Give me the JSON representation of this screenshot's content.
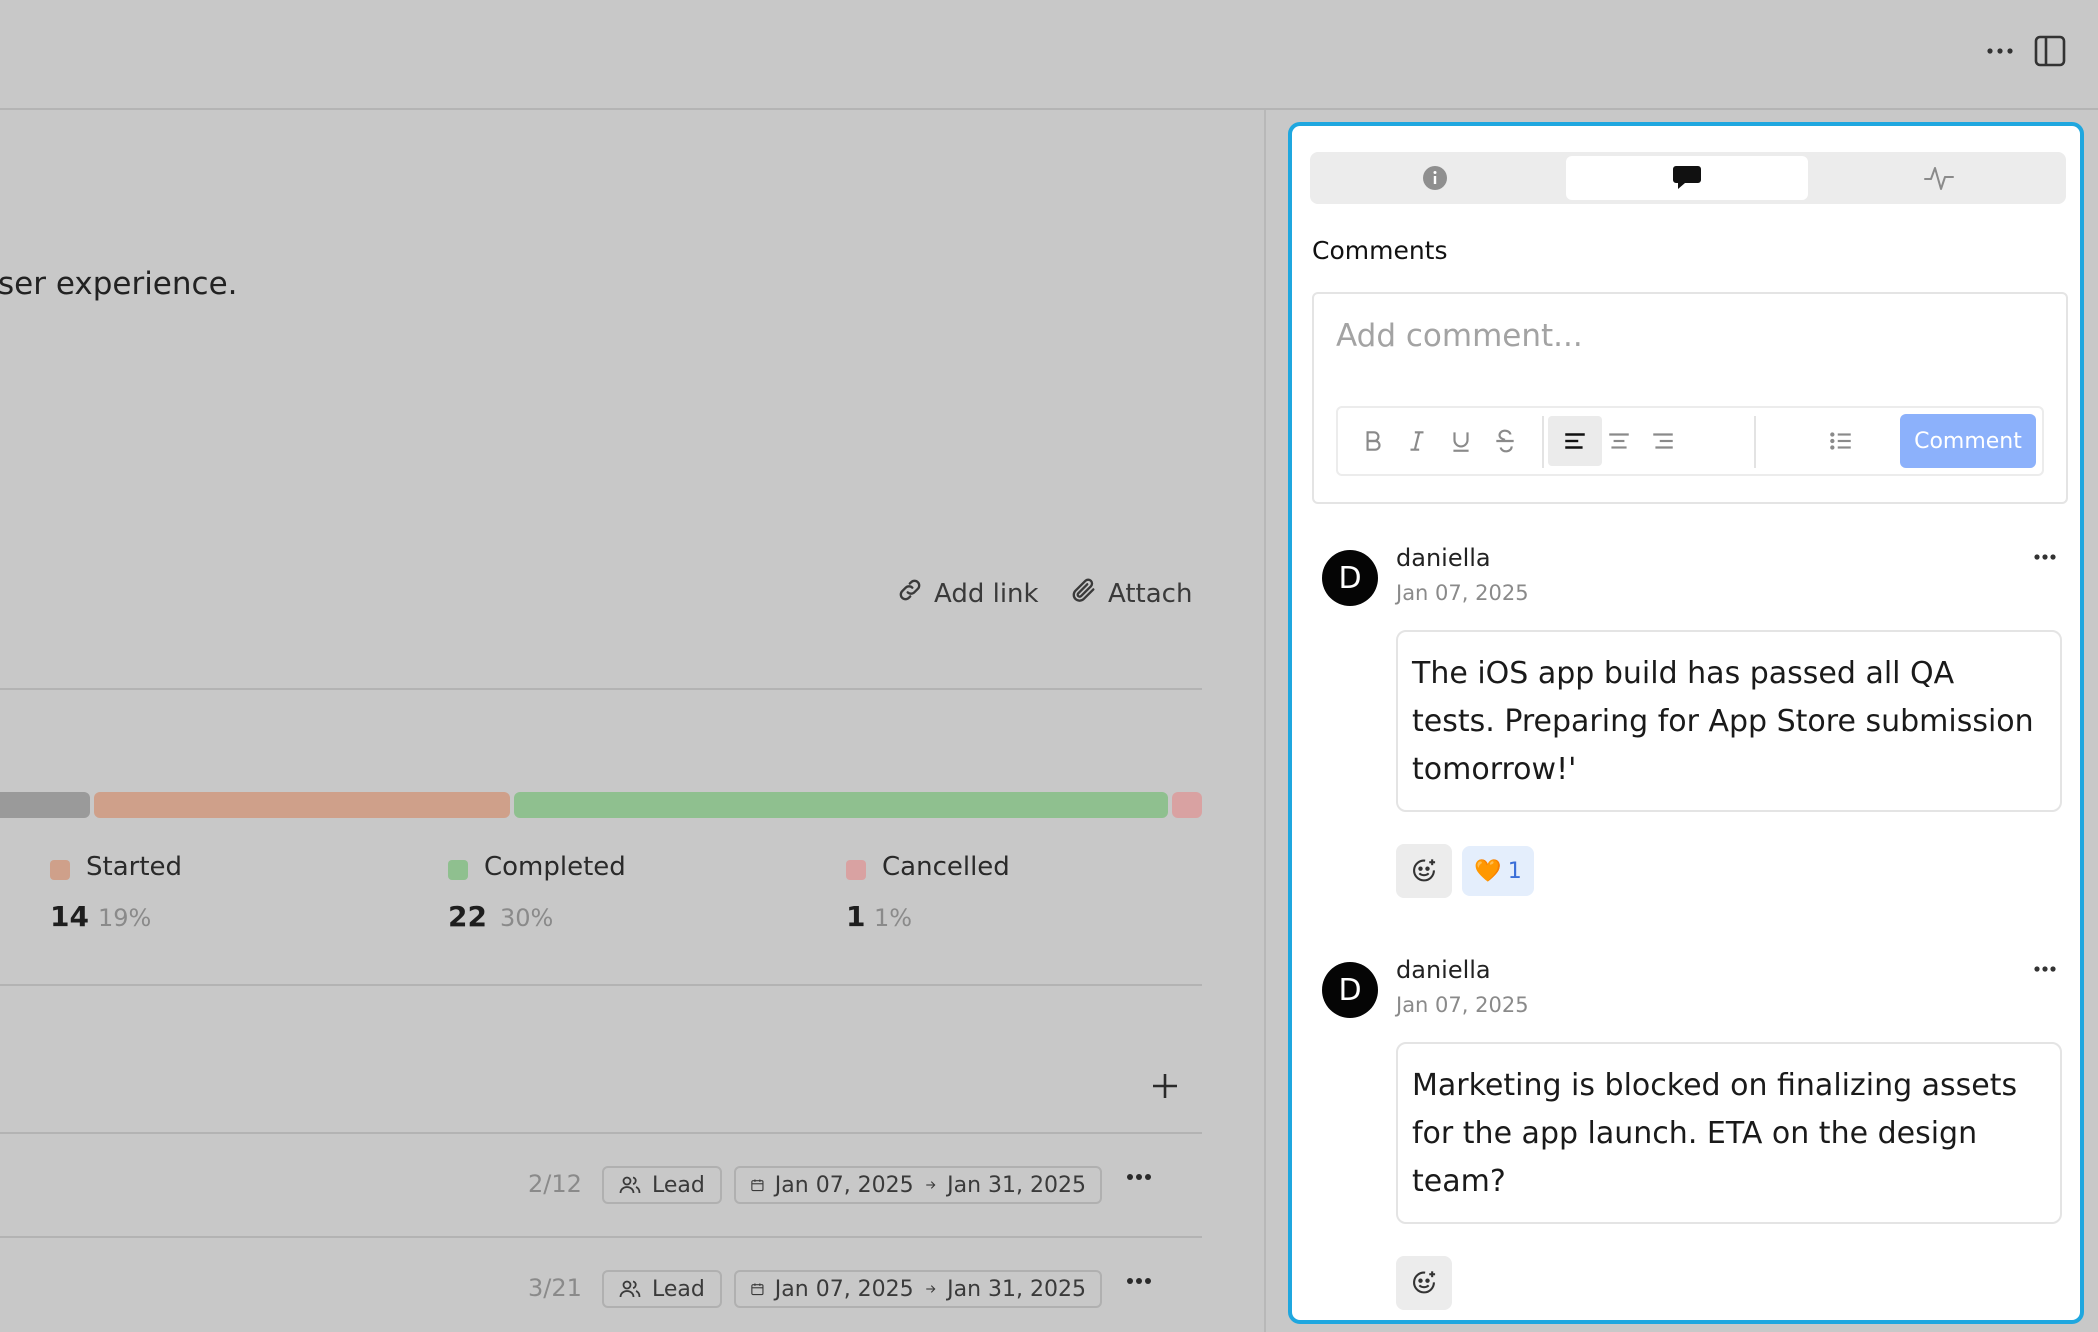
{
  "topbar": {
    "more_icon": "more-horizontal-icon",
    "panel_icon": "sidebar-panel-icon"
  },
  "main": {
    "description_fragment": "ser experience.",
    "add_link": "Add link",
    "attach": "Attach",
    "progress": {
      "segment_colors": [
        "#9a9a9a",
        "#cfa08a",
        "#8fc08f",
        "#d9a2a2"
      ],
      "legend": [
        {
          "label": "Started",
          "count": "14",
          "percent": "19%",
          "color": "#cfa08a"
        },
        {
          "label": "Completed",
          "count": "22",
          "percent": "30%",
          "color": "#8fc08f"
        },
        {
          "label": "Cancelled",
          "count": "1",
          "percent": "1%",
          "color": "#d9a2a2"
        }
      ]
    },
    "add_icon": "plus-icon",
    "rows": [
      {
        "count": "2/12",
        "lead": "Lead",
        "start": "Jan 07, 2025",
        "end": "Jan 31, 2025"
      },
      {
        "count": "3/21",
        "lead": "Lead",
        "start": "Jan 07, 2025",
        "end": "Jan 31, 2025"
      }
    ]
  },
  "panel": {
    "tabs": [
      {
        "icon": "info-icon",
        "active": false
      },
      {
        "icon": "comment-icon",
        "active": true
      },
      {
        "icon": "activity-icon",
        "active": false
      }
    ],
    "title": "Comments",
    "editor": {
      "placeholder": "Add comment...",
      "submit": "Comment",
      "tools": [
        "bold-icon",
        "italic-icon",
        "underline-icon",
        "strikethrough-icon",
        "align-left-icon",
        "align-center-icon",
        "align-right-icon",
        "bullet-list-icon"
      ]
    },
    "comments": [
      {
        "initial": "D",
        "author": "daniella",
        "date": "Jan 07, 2025",
        "text": "The iOS app build has passed all QA tests. Preparing for App Store submission tomorrow!'",
        "reaction_emoji": "🧡",
        "reaction_count": "1"
      },
      {
        "initial": "D",
        "author": "daniella",
        "date": "Jan 07, 2025",
        "text": "Marketing is blocked on finalizing assets for the app launch. ETA on the design team?"
      }
    ]
  },
  "colors": {
    "accent": "#1fa7df",
    "button": "#8cb1fb",
    "overlay": "#c8c8c8"
  }
}
